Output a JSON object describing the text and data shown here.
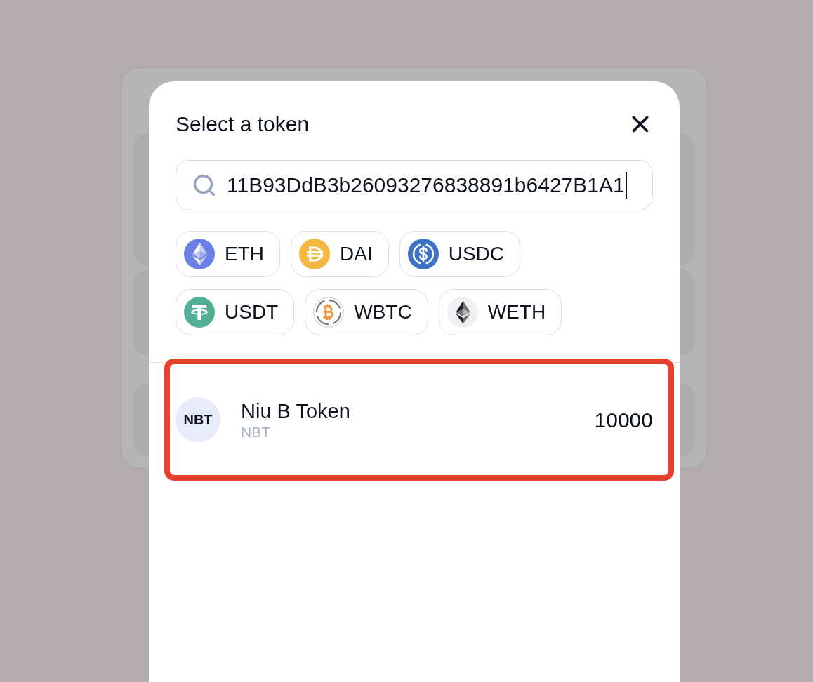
{
  "dialog": {
    "title": "Select a token"
  },
  "search": {
    "value": "11B93DdB3b26093276838891b6427B1A1",
    "focused": true
  },
  "common_tokens": [
    {
      "symbol": "ETH"
    },
    {
      "symbol": "DAI"
    },
    {
      "symbol": "USDC"
    },
    {
      "symbol": "USDT"
    },
    {
      "symbol": "WBTC"
    },
    {
      "symbol": "WETH"
    }
  ],
  "token_list": [
    {
      "avatar": "NBT",
      "name": "Niu B Token",
      "symbol": "NBT",
      "balance": "10000",
      "highlighted": true
    }
  ]
}
